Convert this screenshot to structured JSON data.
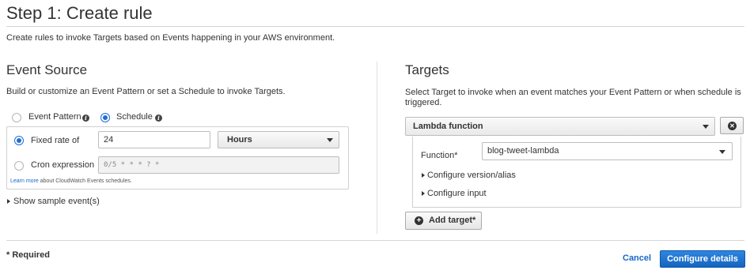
{
  "header": {
    "title": "Step 1: Create rule",
    "description": "Create rules to invoke Targets based on Events happening in your AWS environment."
  },
  "event_source": {
    "title": "Event Source",
    "description": "Build or customize an Event Pattern or set a Schedule to invoke Targets.",
    "mode_options": [
      {
        "label": "Event Pattern",
        "selected": false
      },
      {
        "label": "Schedule",
        "selected": true
      }
    ],
    "fixed_rate": {
      "label": "Fixed rate of",
      "selected": true,
      "value": "24",
      "unit": "Hours"
    },
    "cron": {
      "label": "Cron expression",
      "selected": false,
      "placeholder": "0/5 * * * ? *"
    },
    "learn_more_link": "Learn more",
    "learn_more_text": "about CloudWatch Events schedules.",
    "show_sample": "Show sample event(s)"
  },
  "targets": {
    "title": "Targets",
    "description_line1": "Select Target to invoke when an event matches your Event Pattern or when schedule is",
    "description_line2": "triggered.",
    "target_type": "Lambda function",
    "function_label": "Function*",
    "function_value": "blog-tweet-lambda",
    "configure_version": "Configure version/alias",
    "configure_input": "Configure input",
    "add_target": "Add target*"
  },
  "footer": {
    "required_note": "* Required",
    "cancel": "Cancel",
    "configure_details": "Configure details"
  },
  "colors": {
    "accent": "#1d6ed6",
    "primary_button": "#1565c0",
    "link": "#1a67c8"
  }
}
